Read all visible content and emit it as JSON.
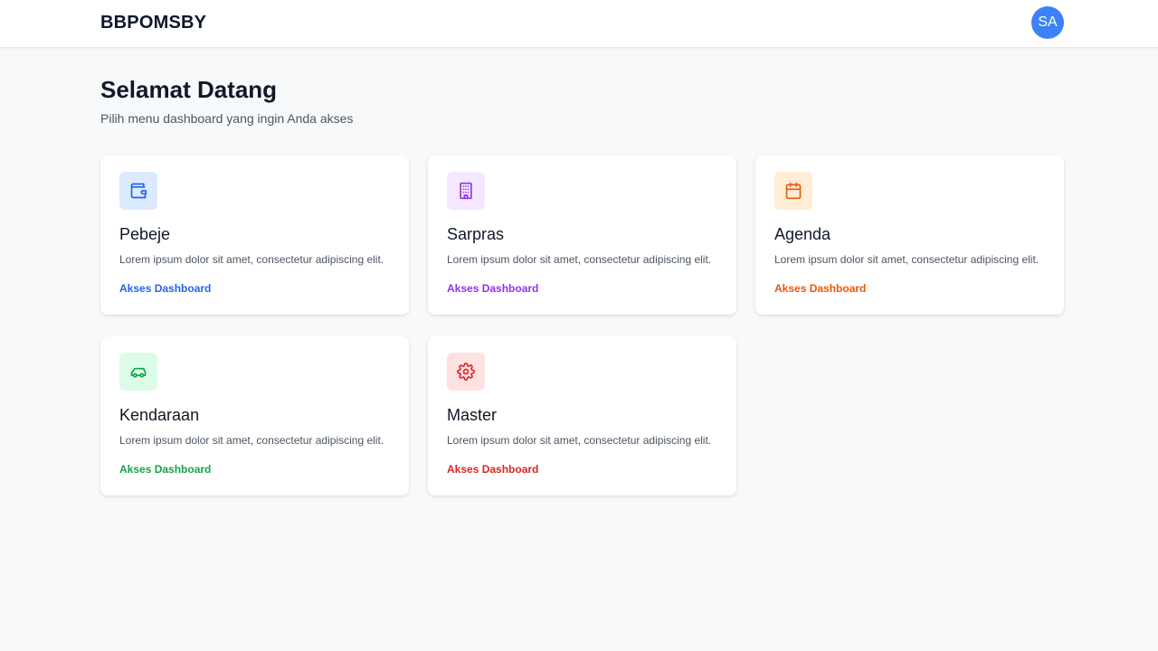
{
  "header": {
    "brand": "BBPOMSBY",
    "avatar_initials": "SA",
    "avatar_color": "#3b82f6"
  },
  "main": {
    "title": "Selamat Datang",
    "subtitle": "Pilih menu dashboard yang ingin Anda akses"
  },
  "cards": [
    {
      "title": "Pebeje",
      "description": "Lorem ipsum dolor sit amet, consectetur adipiscing elit.",
      "link_label": "Akses Dashboard",
      "icon": "wallet-icon",
      "accent": "#2563eb",
      "icon_bg": "#dbeafe"
    },
    {
      "title": "Sarpras",
      "description": "Lorem ipsum dolor sit amet, consectetur adipiscing elit.",
      "link_label": "Akses Dashboard",
      "icon": "building-icon",
      "accent": "#9333ea",
      "icon_bg": "#f3e8ff"
    },
    {
      "title": "Agenda",
      "description": "Lorem ipsum dolor sit amet, consectetur adipiscing elit.",
      "link_label": "Akses Dashboard",
      "icon": "calendar-icon",
      "accent": "#ea580c",
      "icon_bg": "#ffedd5"
    },
    {
      "title": "Kendaraan",
      "description": "Lorem ipsum dolor sit amet, consectetur adipiscing elit.",
      "link_label": "Akses Dashboard",
      "icon": "car-icon",
      "accent": "#16a34a",
      "icon_bg": "#dcfce7"
    },
    {
      "title": "Master",
      "description": "Lorem ipsum dolor sit amet, consectetur adipiscing elit.",
      "link_label": "Akses Dashboard",
      "icon": "gear-icon",
      "accent": "#dc2626",
      "icon_bg": "#fee2e2"
    }
  ]
}
